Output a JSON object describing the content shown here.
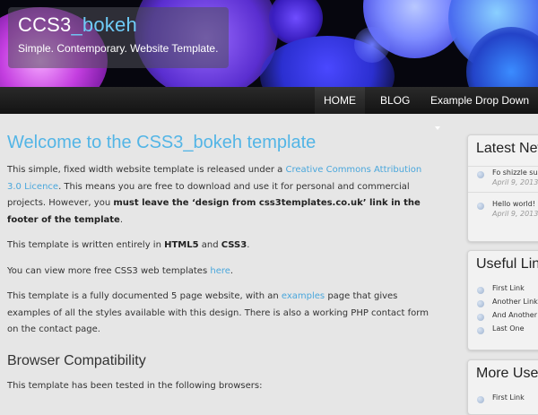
{
  "header": {
    "title_part1": "CCS3",
    "title_part2": "_bokeh",
    "slogan": "Simple. Contemporary. Website Template."
  },
  "nav": {
    "items": [
      {
        "label": "HOME"
      },
      {
        "label": "BLOG"
      },
      {
        "label": "Example Drop Down"
      }
    ]
  },
  "main": {
    "title": "Welcome to the CSS3_bokeh template",
    "p1": {
      "t1": "This simple, fixed width website template is released under a ",
      "link1": "Creative Commons Attribution 3.0 Licence",
      "t2": ". This means you are free to download and use it for personal and commercial projects. However, you ",
      "bold": "must leave the ‘design from css3templates.co.uk’ link in the footer of the template",
      "t3": "."
    },
    "p2": {
      "t1": "This template is written entirely in ",
      "b1": "HTML5",
      "t2": " and ",
      "b2": "CSS3",
      "t3": "."
    },
    "p3": {
      "t1": "You can view more free CSS3 web templates ",
      "link": "here",
      "t2": "."
    },
    "p4": {
      "t1": "This template is a fully documented 5 page website, with an ",
      "link": "examples",
      "t2": " page that gives examples of all the styles available with this design. There is also a working PHP contact form on the contact page."
    },
    "section_title": "Browser Compatibility",
    "p5": "This template has been tested in the following browsers:"
  },
  "sidebar": {
    "latest_news": {
      "title": "Latest New",
      "items": [
        {
          "text": "Fo shizzle sus",
          "date": "April 9, 2013"
        },
        {
          "text": "Hello world!",
          "date": "April 9, 2013"
        }
      ]
    },
    "useful_links": {
      "title": "Useful Link",
      "items": [
        "First Link",
        "Another Link",
        "And Another",
        "Last One"
      ]
    },
    "more_useful": {
      "title": "More Usefu",
      "items": [
        "First Link"
      ]
    }
  },
  "colors": {
    "accent": "#53b5e6",
    "nav_bg": "#1b1b1b",
    "page_bg": "#e6e6e6"
  }
}
